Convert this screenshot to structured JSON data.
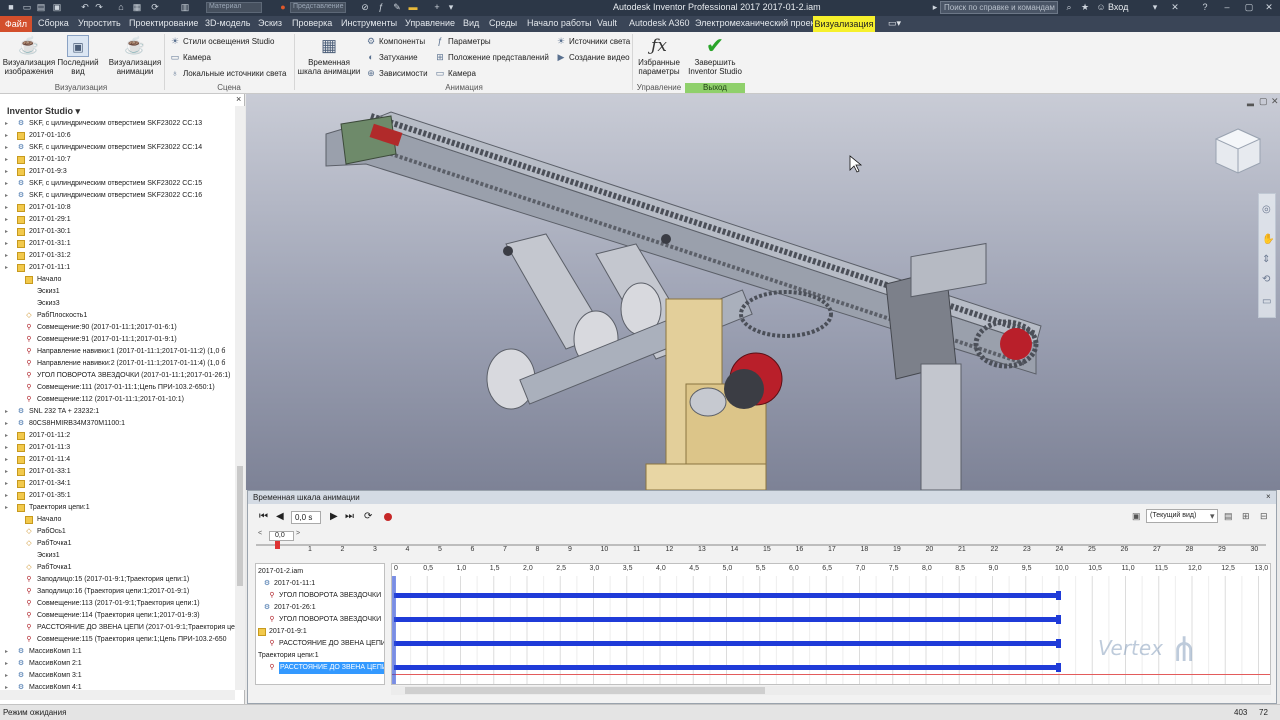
{
  "title_bar": {
    "app_title": "Autodesk Inventor Professional 2017   2017-01-2.iam",
    "search_placeholder": "Поиск по справке и командам",
    "login_label": "Вход",
    "quick_dropdown_1": "Материал",
    "quick_dropdown_2": "Представление"
  },
  "menu": {
    "file": "Файл",
    "items": [
      "Сборка",
      "Упростить",
      "Проектирование",
      "3D-модель",
      "Эскиз",
      "Проверка",
      "Инструменты",
      "Управление",
      "Вид",
      "Среды",
      "Начало работы",
      "Vault",
      "Autodesk A360",
      "Электромеханический проект"
    ],
    "active": "Визуализация"
  },
  "ribbon": {
    "btn_render": "Визуализация изображения",
    "btn_last": "Последний вид",
    "btn_anim": "Визуализация анимации",
    "lighting": "Стили освещения Studio",
    "camera": "Камера",
    "local_lights": "Локальные источники света",
    "timeline_btn": "Временная шкала анимации",
    "components": "Компоненты",
    "fade": "Затухание",
    "constraints": "Зависимости",
    "params": "Параметры",
    "positional": "Положение представлений",
    "camera2": "Камера",
    "light_src": "Источники света",
    "video": "Создание видео",
    "fav_params": "Избранные параметры",
    "finish": "Завершить Inventor Studio",
    "group_render": "Визуализация",
    "group_scene": "Сцена",
    "group_anim": "Анимация",
    "group_manage": "Управление",
    "group_exit": "Выход"
  },
  "browser": {
    "header": "Inventor Studio ▾",
    "close": "×",
    "items": [
      {
        "label": "SKF, с цилиндрическим отверстием SKF23022 CC:13",
        "icon": "asm",
        "indent": 0
      },
      {
        "label": "2017-01-10:6",
        "icon": "sub",
        "indent": 0
      },
      {
        "label": "SKF, с цилиндрическим отверстием SKF23022 CC:14",
        "icon": "asm",
        "indent": 0
      },
      {
        "label": "2017-01-10:7",
        "icon": "sub",
        "indent": 0
      },
      {
        "label": "2017-01-9:3",
        "icon": "sub",
        "indent": 0
      },
      {
        "label": "SKF, с цилиндрическим отверстием SKF23022 CC:15",
        "icon": "asm",
        "indent": 0
      },
      {
        "label": "SKF, с цилиндрическим отверстием SKF23022 CC:16",
        "icon": "asm",
        "indent": 0
      },
      {
        "label": "2017-01-10:8",
        "icon": "sub",
        "indent": 0
      },
      {
        "label": "2017-01-29:1",
        "icon": "sub",
        "indent": 0
      },
      {
        "label": "2017-01-30:1",
        "icon": "sub",
        "indent": 0
      },
      {
        "label": "2017-01-31:1",
        "icon": "sub",
        "indent": 0
      },
      {
        "label": "2017-01-31:2",
        "icon": "sub",
        "indent": 0
      },
      {
        "label": "2017-01-11:1",
        "icon": "sub",
        "indent": 0
      },
      {
        "label": "Начало",
        "icon": "fold",
        "indent": 1
      },
      {
        "label": "Эскиз1",
        "icon": "none",
        "indent": 1
      },
      {
        "label": "Эскиз3",
        "icon": "none",
        "indent": 1
      },
      {
        "label": "РабПлоскость1",
        "icon": "work",
        "indent": 1
      },
      {
        "label": "Совмещение:90 (2017-01-11:1;2017-01-6:1)",
        "icon": "cons",
        "indent": 1
      },
      {
        "label": "Совмещение:91 (2017-01-11:1;2017-01-9:1)",
        "icon": "cons",
        "indent": 1
      },
      {
        "label": "Направление навивки:1 (2017-01-11:1;2017-01-11:2) (1,0 б",
        "icon": "cons",
        "indent": 1
      },
      {
        "label": "Направление навивки:2 (2017-01-11:1;2017-01-11:4) (1,0 б",
        "icon": "cons",
        "indent": 1
      },
      {
        "label": "УГОЛ ПОВОРОТА ЗВЕЗДОЧКИ (2017-01-11:1;2017-01-26:1)",
        "icon": "cons",
        "indent": 1
      },
      {
        "label": "Совмещение:111 (2017-01-11:1;Цепь ПРИ-103.2-650:1)",
        "icon": "cons",
        "indent": 1
      },
      {
        "label": "Совмещение:112 (2017-01-11:1;2017-01-10:1)",
        "icon": "cons",
        "indent": 1
      },
      {
        "label": "SNL 232 TA + 23232:1",
        "icon": "asm",
        "indent": 0
      },
      {
        "label": "80CS8HMIRB34M370M1100:1",
        "icon": "asm",
        "indent": 0
      },
      {
        "label": "2017-01-11:2",
        "icon": "sub",
        "indent": 0
      },
      {
        "label": "2017-01-11:3",
        "icon": "sub",
        "indent": 0
      },
      {
        "label": "2017-01-11:4",
        "icon": "sub",
        "indent": 0
      },
      {
        "label": "2017-01-33:1",
        "icon": "sub",
        "indent": 0
      },
      {
        "label": "2017-01-34:1",
        "icon": "sub",
        "indent": 0
      },
      {
        "label": "2017-01-35:1",
        "icon": "sub",
        "indent": 0
      },
      {
        "label": "Траектория цепи:1",
        "icon": "sub",
        "indent": 0
      },
      {
        "label": "Начало",
        "icon": "fold",
        "indent": 1
      },
      {
        "label": "РабОсь1",
        "icon": "work",
        "indent": 1
      },
      {
        "label": "РабТочка1",
        "icon": "work",
        "indent": 1
      },
      {
        "label": "Эскиз1",
        "icon": "none",
        "indent": 1
      },
      {
        "label": "РабТочка1",
        "icon": "work",
        "indent": 1
      },
      {
        "label": "Заподлицо:15 (2017-01-9:1;Траектория цепи:1)",
        "icon": "cons",
        "indent": 1
      },
      {
        "label": "Заподлицо:16 (Траектория цепи:1;2017-01-9:1)",
        "icon": "cons",
        "indent": 1
      },
      {
        "label": "Совмещение:113 (2017-01-9:1;Траектория цепи:1)",
        "icon": "cons",
        "indent": 1
      },
      {
        "label": "Совмещение:114 (Траектория цепи:1;2017-01-9:3)",
        "icon": "cons",
        "indent": 1
      },
      {
        "label": "РАССТОЯНИЕ ДО ЗВЕНА ЦЕПИ (2017-01-9:1;Траектория цепи",
        "icon": "cons",
        "indent": 1
      },
      {
        "label": "Совмещение:115 (Траектория цепи:1;Цепь ПРИ-103.2-650",
        "icon": "cons",
        "indent": 1
      },
      {
        "label": "МассивКомп 1:1",
        "icon": "asm",
        "indent": 0
      },
      {
        "label": "МассивКомп 2:1",
        "icon": "asm",
        "indent": 0
      },
      {
        "label": "МассивКомп 3:1",
        "icon": "asm",
        "indent": 0
      },
      {
        "label": "МассивКомп 4:1",
        "icon": "asm",
        "indent": 0
      }
    ]
  },
  "timeline": {
    "title": "Временная шкала анимации",
    "close": "×",
    "time_value": "0,0 s",
    "camera_select": "(Текущий вид)",
    "range_field": "0,0",
    "range_max": "30",
    "range_ticks": [
      "1",
      "2",
      "3",
      "4",
      "5",
      "6",
      "7",
      "8",
      "9",
      "10",
      "11",
      "12",
      "13",
      "14",
      "15",
      "16",
      "17",
      "18",
      "19",
      "20",
      "21",
      "22",
      "23",
      "24",
      "25",
      "26",
      "27",
      "28",
      "29",
      "30"
    ],
    "track_ticks": [
      "0",
      "0,5",
      "1,0",
      "1,5",
      "2,0",
      "2,5",
      "3,0",
      "3,5",
      "4,0",
      "4,5",
      "5,0",
      "5,5",
      "6,0",
      "6,5",
      "7,0",
      "7,5",
      "8,0",
      "8,5",
      "9,0",
      "9,5",
      "10,0",
      "10,5",
      "11,0",
      "11,5",
      "12,0",
      "12,5",
      "13,0"
    ],
    "rows": [
      {
        "label": "2017-01-2.iam",
        "icon": "none",
        "indent": 0,
        "selected": false
      },
      {
        "label": "2017-01-11:1",
        "icon": "asm",
        "indent": 1,
        "selected": false
      },
      {
        "label": "УГОЛ ПОВОРОТА ЗВЕЗДОЧКИ",
        "icon": "cons",
        "indent": 2,
        "selected": false
      },
      {
        "label": "2017-01-26:1",
        "icon": "asm",
        "indent": 1,
        "selected": false
      },
      {
        "label": "УГОЛ ПОВОРОТА ЗВЕЗДОЧКИ",
        "icon": "cons",
        "indent": 2,
        "selected": false
      },
      {
        "label": "2017-01-9:1",
        "icon": "sub",
        "indent": 0,
        "selected": false
      },
      {
        "label": "РАССТОЯНИЕ ДО ЗВЕНА ЦЕПИ",
        "icon": "cons",
        "indent": 2,
        "selected": false
      },
      {
        "label": "Траектория цепи:1",
        "icon": "none",
        "indent": 0,
        "selected": false
      },
      {
        "label": "РАССТОЯНИЕ ДО ЗВЕНА ЦЕПИ",
        "icon": "cons",
        "indent": 2,
        "selected": true
      }
    ],
    "actions": [
      {
        "start": 0,
        "end": 10
      },
      {
        "start": 0,
        "end": 10
      },
      {
        "start": 0,
        "end": 10
      },
      {
        "start": 0,
        "end": 10
      }
    ]
  },
  "status": {
    "text": "Режим ожидания",
    "n1": "403",
    "n2": "72"
  },
  "watermark": "Vertex"
}
